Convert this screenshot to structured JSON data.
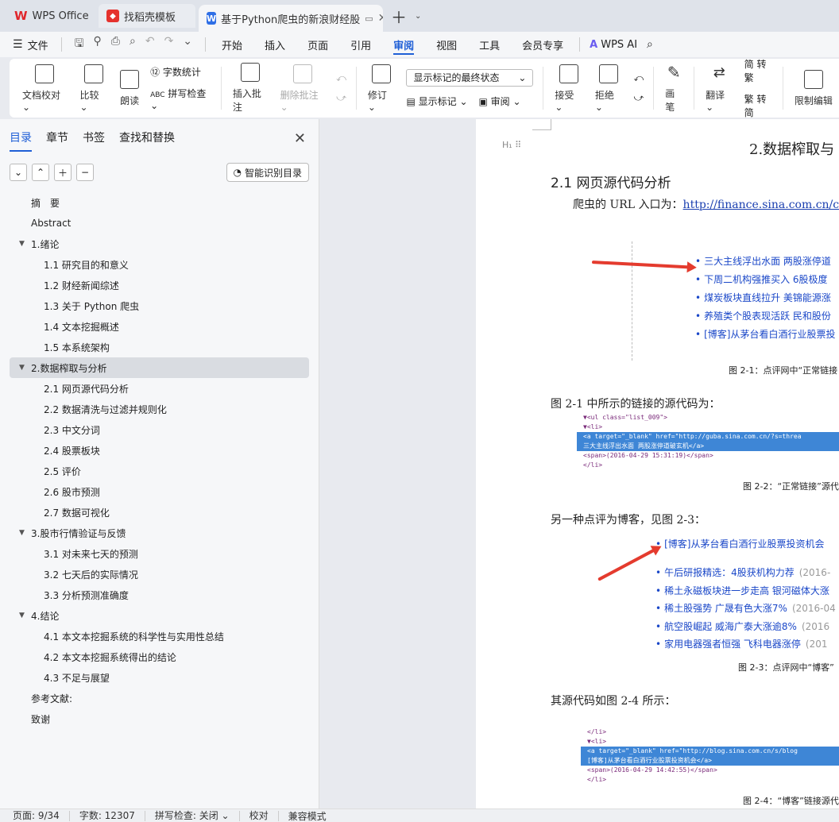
{
  "tabs": {
    "wps": "WPS Office",
    "template": "找稻壳模板",
    "document": "基于Python爬虫的新浪财经股"
  },
  "menu": {
    "file": "文件",
    "items": [
      "开始",
      "插入",
      "页面",
      "引用",
      "审阅",
      "视图",
      "工具",
      "会员专享"
    ],
    "ai": "WPS AI"
  },
  "ribbon": {
    "doc_check": "文档校对",
    "compare": "比较",
    "read_aloud": "朗读",
    "word_count": "字数统计",
    "spell_check": "拼写检查",
    "insert_comment": "插入批注",
    "delete_comment": "删除批注",
    "revise": "修订",
    "markup_select": "显示标记的最终状态",
    "show_markup": "显示标记",
    "review": "审阅",
    "accept": "接受",
    "reject": "拒绝",
    "pen": "画笔",
    "translate": "翻译",
    "to_traditional": "转繁",
    "to_simplified": "转简",
    "restrict_edit": "限制编辑"
  },
  "nav": {
    "tabs": [
      "目录",
      "章节",
      "书签",
      "查找和替换"
    ],
    "smart_toc": "智能识别目录",
    "toc": [
      {
        "level": "l1",
        "label": "摘　要"
      },
      {
        "level": "l1",
        "label": "Abstract"
      },
      {
        "level": "l1c",
        "label": "1.绪论"
      },
      {
        "level": "l2",
        "label": "1.1  研究目的和意义"
      },
      {
        "level": "l2",
        "label": "1.2  财经新闻综述"
      },
      {
        "level": "l2",
        "label": "1.3  关于 Python 爬虫"
      },
      {
        "level": "l2",
        "label": "1.4  文本挖掘概述"
      },
      {
        "level": "l2",
        "label": "1.5 本系统架构"
      },
      {
        "level": "sel",
        "label": "2.数据榨取与分析"
      },
      {
        "level": "l2",
        "label": "2.1  网页源代码分析"
      },
      {
        "level": "l2",
        "label": "2.2  数据清洗与过滤并规则化"
      },
      {
        "level": "l2",
        "label": "2.3  中文分词"
      },
      {
        "level": "l2",
        "label": "2.4  股票板块"
      },
      {
        "level": "l2",
        "label": "2.5  评价"
      },
      {
        "level": "l2",
        "label": "2.6  股市预测"
      },
      {
        "level": "l2",
        "label": "2.7  数据可视化"
      },
      {
        "level": "l1c",
        "label": "3.股市行情验证与反馈"
      },
      {
        "level": "l2",
        "label": "3.1  对未来七天的预测"
      },
      {
        "level": "l2",
        "label": "3.2  七天后的实际情况"
      },
      {
        "level": "l2",
        "label": "3.3  分析预测准确度"
      },
      {
        "level": "l1c",
        "label": "4.结论"
      },
      {
        "level": "l2",
        "label": "4.1  本文本挖掘系统的科学性与实用性总结"
      },
      {
        "level": "l2",
        "label": "4.2  本文本挖掘系统得出的结论"
      },
      {
        "level": "l2",
        "label": "4.3  不足与展望"
      },
      {
        "level": "l1",
        "label": "参考文献:"
      },
      {
        "level": "l1",
        "label": "致谢"
      }
    ]
  },
  "doc": {
    "chapter_title": "2.数据榨取与",
    "section_title": "2.1  网页源代码分析",
    "url_intro": "爬虫的 URL 入口为：",
    "url": "http://finance.sina.com.cn/co",
    "fig1_lines": [
      "三大主线浮出水面 两股涨停道",
      "下周二机构强推买入 6股极度",
      "煤炭板块直线拉升 美锦能源涨",
      "养殖类个股表现活跃 民和股份",
      "[博客]从茅台看白酒行业股票投"
    ],
    "fig1_caption": "图 2-1：点评网中“正常链接",
    "para2": "图 2-1 中所示的链接的源代码为：",
    "code1": [
      "▼<ul class=\"list_009\">",
      "  ▼<li>",
      "    <a target=\"_blank\" href=\"http://guba.sina.com.cn/?s=threa",
      "    三大主线浮出水面 两股涨停道破玄机</a>",
      "    <span>(2016-04-29 15:31:19)</span>",
      "  </li>"
    ],
    "fig2_caption": "图 2-2：“正常链接”源代",
    "para3": "另一种点评为博客，见图 2-3：",
    "fig3_lines": [
      {
        "t": "[博客]从茅台看白酒行业股票投资机会",
        "d": ""
      },
      {
        "t": "午后研报精选：4股获机构力荐",
        "d": "(2016-"
      },
      {
        "t": "稀土永磁板块进一步走高 银河磁体大涨",
        "d": ""
      },
      {
        "t": "稀土股强势 广晟有色大涨7%",
        "d": "(2016-04"
      },
      {
        "t": "航空股崛起 威海广泰大涨逾8%",
        "d": "(2016"
      },
      {
        "t": "家用电器强者恒强 飞科电器涨停",
        "d": "(201"
      }
    ],
    "fig3_caption": "图 2-3：点评网中“博客”",
    "para4": "其源代码如图 2-4 所示：",
    "code2": [
      "    </li>",
      "  ▼<li>",
      "    <a target=\"_blank\" href=\"http://blog.sina.com.cn/s/blog",
      "    [博客]从茅台看白酒行业股票投资机会</a>",
      "    <span>(2016-04-29 14:42:55)</span>",
      "  </li>"
    ],
    "fig4_caption": "图 2-4：“博客”链接源代"
  },
  "status": {
    "page": "页面: 9/34",
    "words": "字数: 12307",
    "spell": "拼写检查: 关闭",
    "proof": "校对",
    "compat": "兼容模式"
  }
}
